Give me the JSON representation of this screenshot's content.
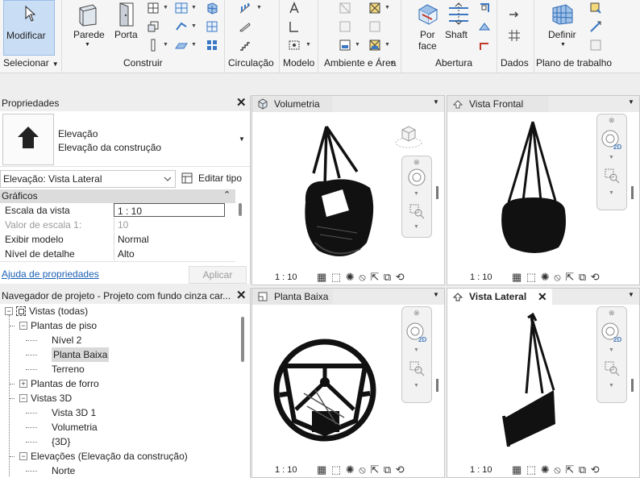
{
  "ribbon": {
    "modify_label": "Modificar",
    "wall_label": "Parede",
    "door_label": "Porta",
    "by_face_label": "Por\nface",
    "shaft_label": "Shaft",
    "define_label": "Definir",
    "panels": [
      "Selecionar",
      "Construir",
      "Circulação",
      "Modelo",
      "Ambiente e Área",
      "Abertura",
      "Dados",
      "Plano de trabalho"
    ]
  },
  "properties": {
    "title": "Propriedades",
    "type_line1": "Elevação",
    "type_line2": "Elevação da construção",
    "selector_value": "Elevação: Vista Lateral",
    "edit_type_label": "Editar tipo",
    "section_label": "Gráficos",
    "rows": [
      {
        "key": "Escala da vista",
        "value": "1 : 10"
      },
      {
        "key": "Valor de escala    1:",
        "value": "10"
      },
      {
        "key": "Exibir modelo",
        "value": "Normal"
      },
      {
        "key": "Nível de detalhe",
        "value": "Alto"
      }
    ],
    "help_link": "Ajuda de propriedades",
    "apply_label": "Aplicar"
  },
  "navigator": {
    "title": "Navegador de projeto - Projeto com fundo cinza car...",
    "items": [
      {
        "label": "Vistas (todas)",
        "level": 0,
        "toggle": "−"
      },
      {
        "label": "Plantas de piso",
        "level": 1,
        "toggle": "−"
      },
      {
        "label": "Nível 2",
        "level": 2,
        "toggle": ""
      },
      {
        "label": "Planta Baixa",
        "level": 2,
        "toggle": ""
      },
      {
        "label": "Terreno",
        "level": 2,
        "toggle": ""
      },
      {
        "label": "Plantas de forro",
        "level": 1,
        "toggle": "+"
      },
      {
        "label": "Vistas 3D",
        "level": 1,
        "toggle": "−"
      },
      {
        "label": "Vista 3D 1",
        "level": 2,
        "toggle": ""
      },
      {
        "label": "Volumetria",
        "level": 2,
        "toggle": ""
      },
      {
        "label": "{3D}",
        "level": 2,
        "toggle": ""
      },
      {
        "label": "Elevações (Elevação da construção)",
        "level": 1,
        "toggle": "−"
      },
      {
        "label": "Norte",
        "level": 2,
        "toggle": ""
      }
    ]
  },
  "views": {
    "volumetria": {
      "title": "Volumetria",
      "scale": "1 : 10"
    },
    "frontal": {
      "title": "Vista Frontal",
      "scale": "1 : 10"
    },
    "planta": {
      "title": "Planta Baixa",
      "scale": "1 : 10"
    },
    "lateral": {
      "title": "Vista Lateral",
      "scale": "1 : 10"
    },
    "nav_2d_label": "2D"
  }
}
